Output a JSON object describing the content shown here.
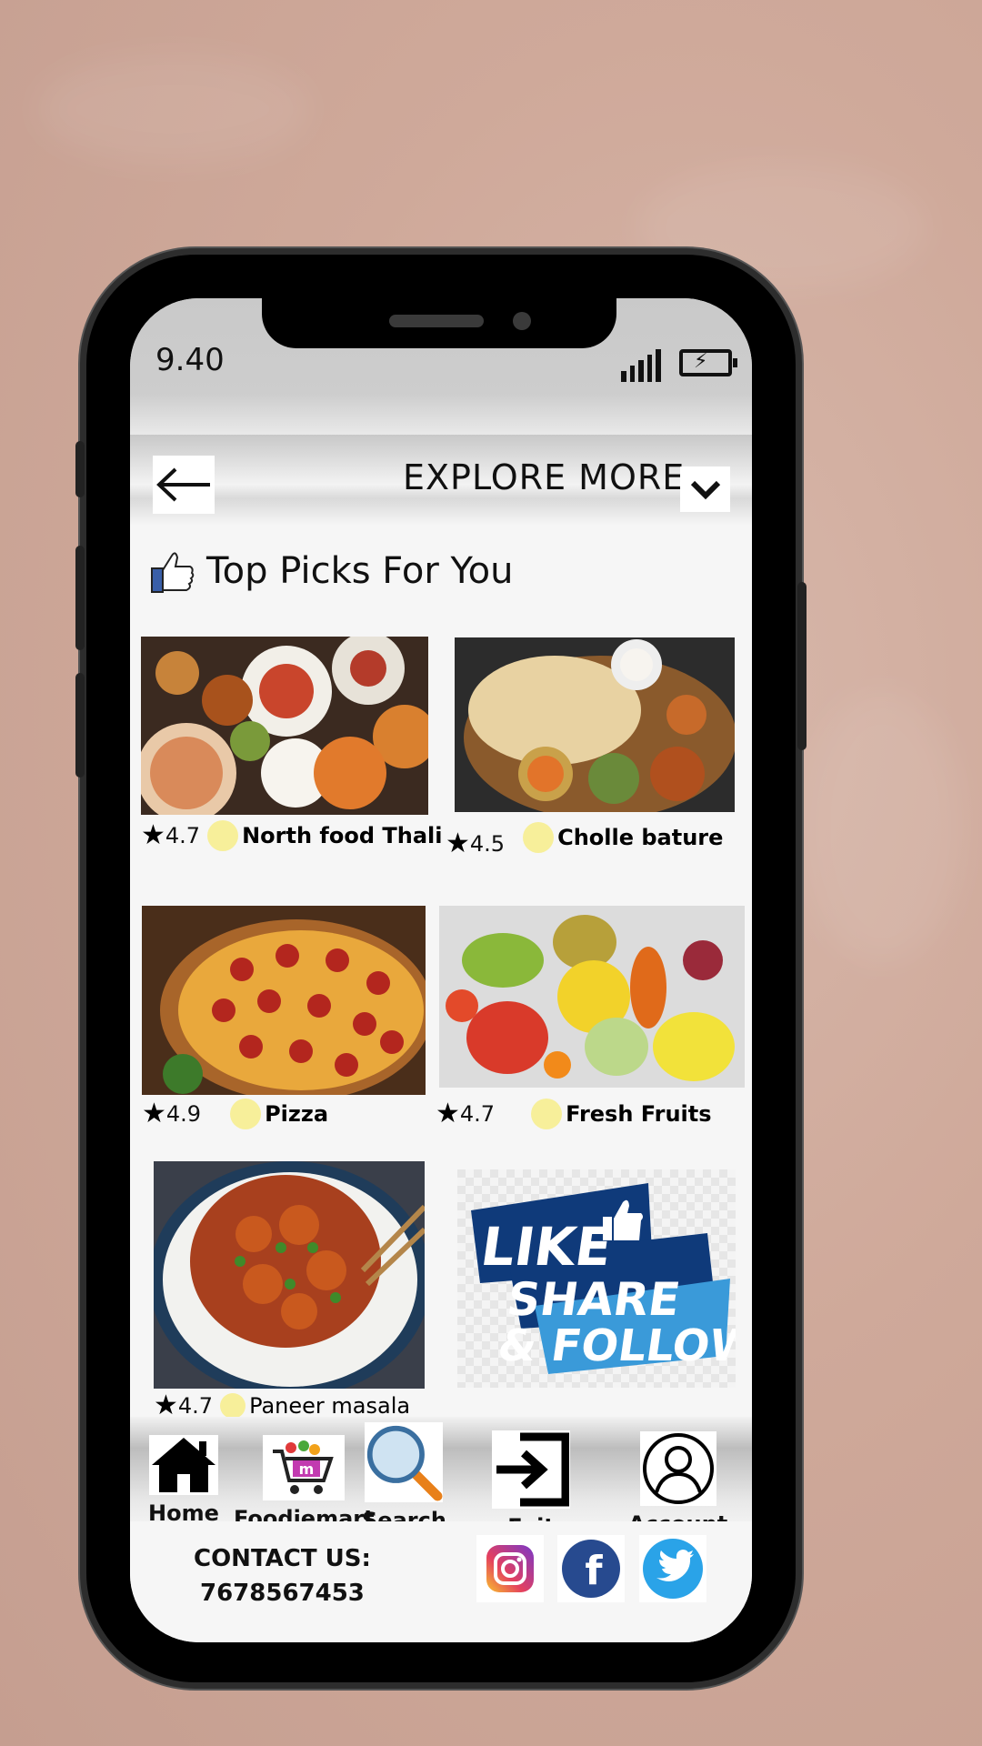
{
  "status": {
    "time": "9.40"
  },
  "header": {
    "title": "EXPLORE MORE"
  },
  "section": {
    "title": "Top Picks For You"
  },
  "items": [
    {
      "rating": "4.7",
      "name": "North food Thali"
    },
    {
      "rating": "4.5",
      "name": "Cholle bature"
    },
    {
      "rating": "4.9",
      "name": "Pizza"
    },
    {
      "rating": "4.7",
      "name": "Fresh Fruits"
    },
    {
      "rating": "4.7",
      "name": "Paneer masala"
    }
  ],
  "promo": {
    "line1": "LIKE",
    "line2": "SHARE",
    "line3": "& FOLLOW"
  },
  "nav": [
    {
      "label": "Home",
      "icon": "home-icon"
    },
    {
      "label": "Foodiemart",
      "icon": "cart-icon"
    },
    {
      "label": "Search",
      "icon": "search-icon"
    },
    {
      "label": "Exit",
      "icon": "exit-icon"
    },
    {
      "label": "Account",
      "icon": "account-icon"
    }
  ],
  "contact": {
    "label": "CONTACT US:",
    "phone": "7678567453"
  },
  "social": [
    "instagram-icon",
    "facebook-icon",
    "twitter-icon"
  ],
  "colors": {
    "background": "#cfa99a",
    "rating_dot": "#f7ef9a",
    "promo_dark": "#0f3a7a",
    "promo_light": "#3a9ad9"
  }
}
